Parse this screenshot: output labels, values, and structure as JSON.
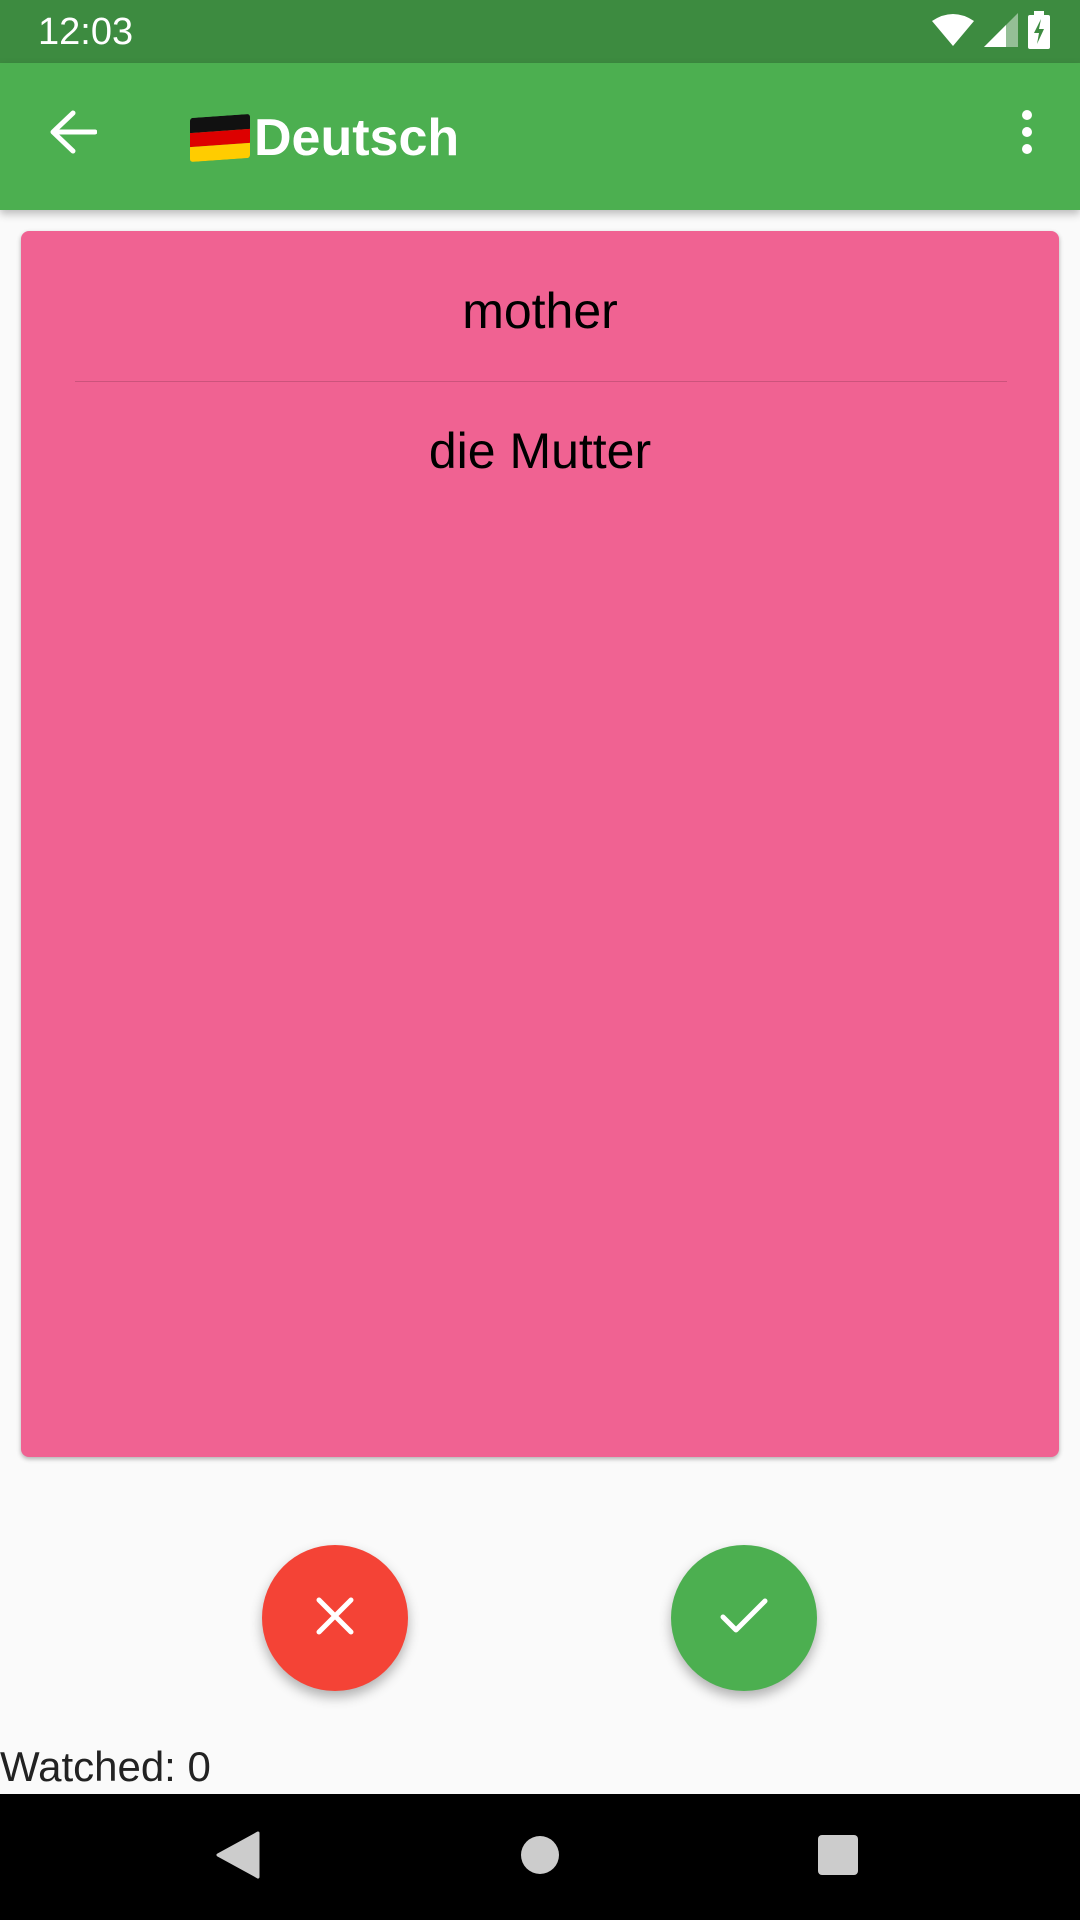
{
  "status_bar": {
    "time": "12:03",
    "icons": [
      "wifi-icon",
      "signal-icon",
      "battery-charging-icon"
    ]
  },
  "app_bar": {
    "back_icon": "arrow-back-icon",
    "flag_icon": "germany-flag-icon",
    "title": "Deutsch",
    "overflow_icon": "more-vert-icon",
    "colors": {
      "bar": "#4caf50",
      "status": "#3d8b40"
    }
  },
  "card": {
    "word": "mother",
    "translation": "die Mutter",
    "color": "#f06292"
  },
  "actions": {
    "wrong_icon": "close-icon",
    "right_icon": "check-icon",
    "wrong_color": "#f44336",
    "right_color": "#4caf50"
  },
  "footer": {
    "watched": "Watched: 0"
  },
  "nav_bar": {
    "icons": [
      "back-triangle-icon",
      "home-circle-icon",
      "recents-square-icon"
    ]
  }
}
